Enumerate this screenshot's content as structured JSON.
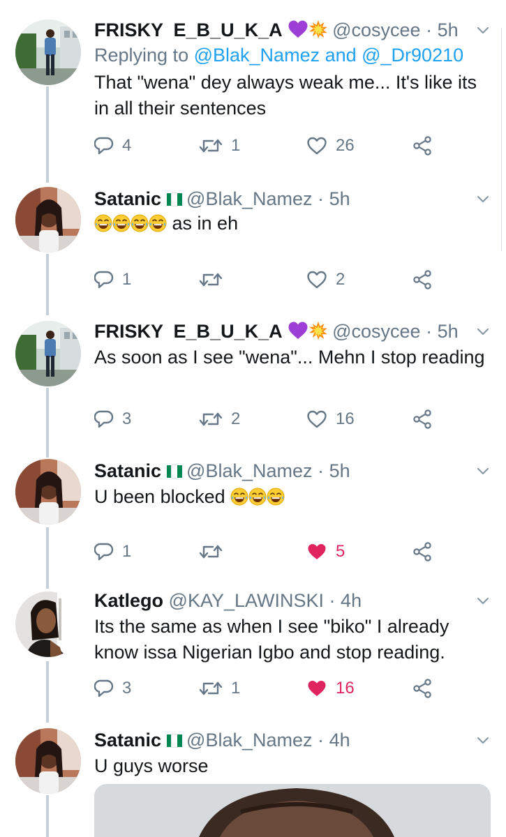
{
  "tweets": [
    {
      "name": "FRISKY  E_B_U_K_A",
      "handle": "@cosycee",
      "separator": "·",
      "time": "5h",
      "reply_prefix": "Replying to",
      "reply_users": "@Blak_Namez and @_Dr90210",
      "text": "That \"wena\" dey always weak me... It's like its in all their sentences",
      "replies": "4",
      "retweets": "1",
      "likes": "26",
      "liked": false
    },
    {
      "name": "Satanic",
      "handle": "@Blak_Namez",
      "separator": "·",
      "time": "5h",
      "text": "as in eh",
      "replies": "1",
      "retweets": "",
      "likes": "2",
      "liked": false
    },
    {
      "name": "FRISKY  E_B_U_K_A",
      "handle": "@cosycee",
      "separator": "·",
      "time": "5h",
      "text": "As soon as I see \"wena\"... Mehn I stop reading",
      "replies": "3",
      "retweets": "2",
      "likes": "16",
      "liked": false
    },
    {
      "name": "Satanic",
      "handle": "@Blak_Namez",
      "separator": "·",
      "time": "5h",
      "text": "U been blocked",
      "replies": "1",
      "retweets": "",
      "likes": "5",
      "liked": true
    },
    {
      "name": "Katlego",
      "handle": "@KAY_LAWINSKI",
      "separator": "·",
      "time": "4h",
      "text": "Its the same as when I see \"biko\" I already know issa Nigerian Igbo and stop reading.",
      "replies": "3",
      "retweets": "1",
      "likes": "16",
      "liked": true
    },
    {
      "name": "Satanic",
      "handle": "@Blak_Namez",
      "separator": "·",
      "time": "4h",
      "text": "U guys worse"
    }
  ],
  "icons": {
    "reply": "reply-icon",
    "retweet": "retweet-icon",
    "like": "heart-icon",
    "share": "share-icon",
    "caret": "chevron-down-icon",
    "emoji_purple_heart": "purple-heart-emoji",
    "emoji_collision": "collision-emoji",
    "emoji_laugh": "tears-of-joy-emoji",
    "flag": "nigeria-flag-emoji"
  },
  "colors": {
    "text": "#14171a",
    "muted": "#657786",
    "link": "#1da1f2",
    "liked": "#e0245e",
    "thread_line": "#c4cfd6"
  }
}
